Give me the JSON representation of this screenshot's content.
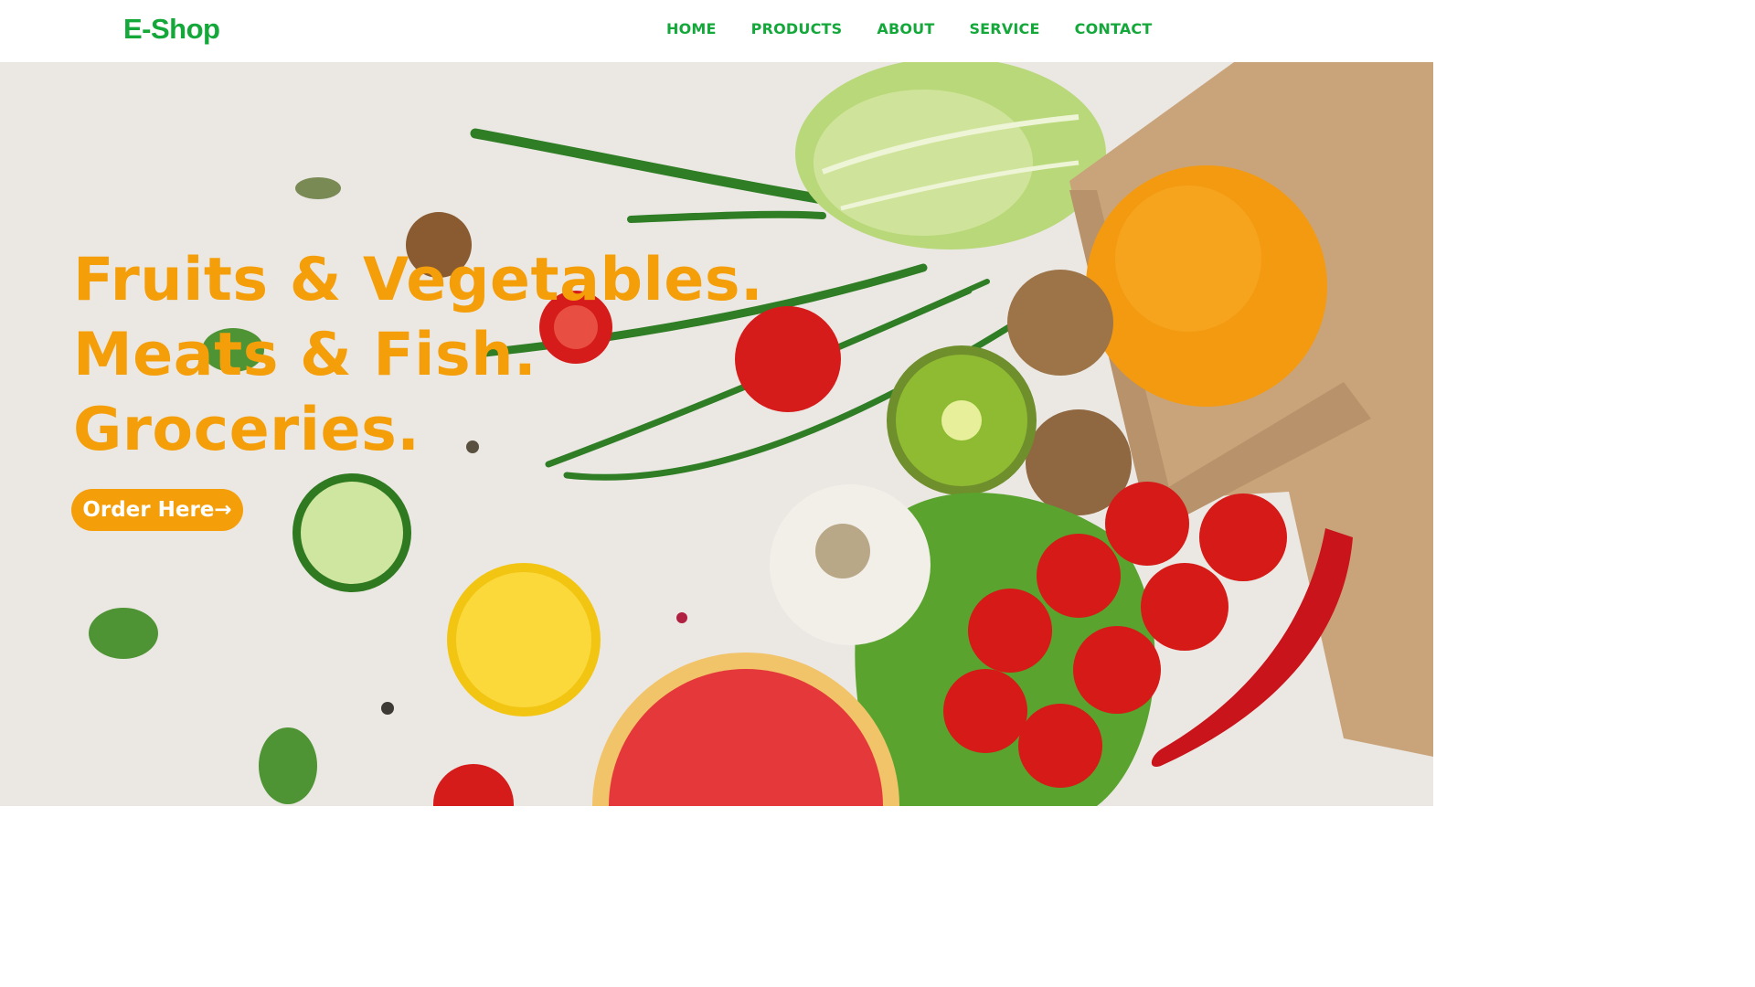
{
  "brand": {
    "logo_text": "E-Shop",
    "brand_color": "#14a83a",
    "accent_color": "#f49e0a"
  },
  "nav": {
    "items": [
      {
        "label": "HOME"
      },
      {
        "label": "PRODUCTS"
      },
      {
        "label": "ABOUT"
      },
      {
        "label": "SERVICE"
      },
      {
        "label": "CONTACT"
      }
    ]
  },
  "hero": {
    "headline_lines": [
      "Fruits & Vegetables.",
      "Meats & Fish.",
      "Groceries."
    ],
    "cta_label": "Order Here→"
  }
}
